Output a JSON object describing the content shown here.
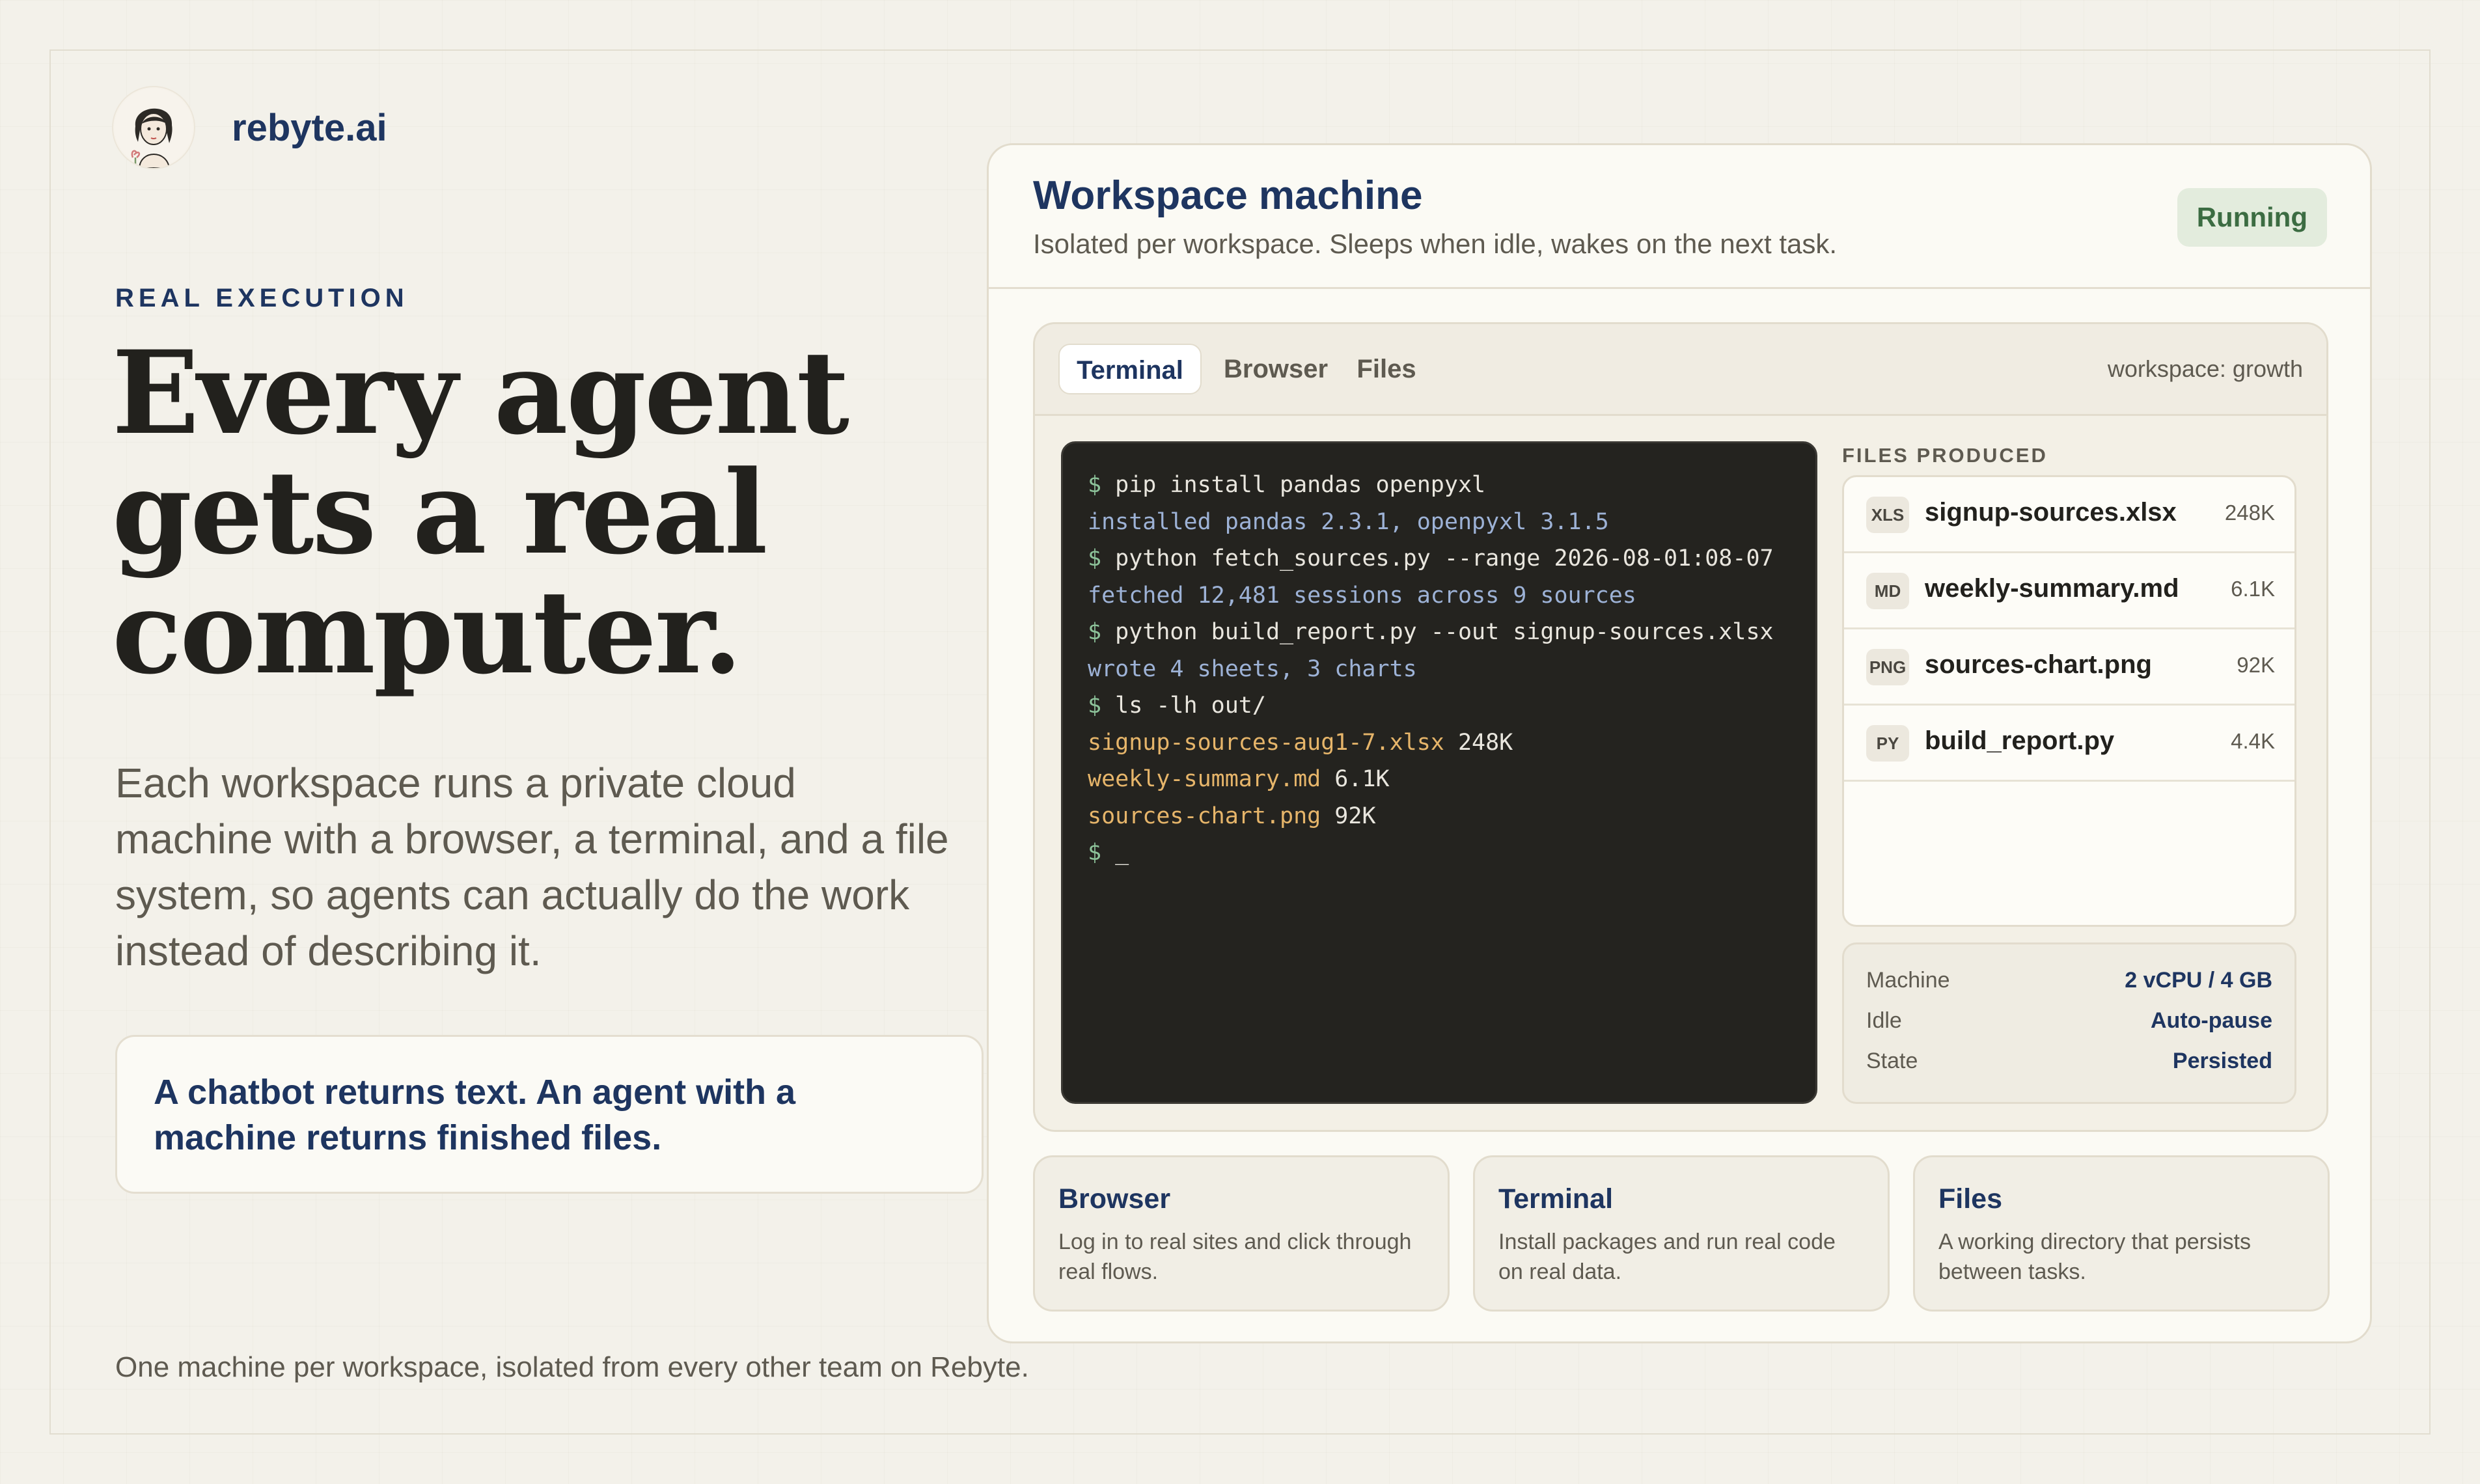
{
  "brand": {
    "name": "rebyte.ai"
  },
  "hero": {
    "eyebrow": "REAL EXECUTION",
    "headline": [
      "Every agent",
      "gets a real",
      "computer."
    ],
    "lede": "Each workspace runs a private cloud machine with a browser, a terminal, and a file system, so agents can actually do the work instead of describing it.",
    "callout": "A chatbot returns text. An agent with a machine returns finished files.",
    "footnote": "One machine per workspace, isolated from every other team on Rebyte."
  },
  "machine": {
    "title": "Workspace machine",
    "subtitle": "Isolated per workspace. Sleeps when idle, wakes on the next task.",
    "status": "Running",
    "status_color": "#3c6c42",
    "tabs": [
      {
        "label": "Terminal",
        "active": true
      },
      {
        "label": "Browser",
        "active": false
      },
      {
        "label": "Files",
        "active": false
      }
    ],
    "workspace_label": "workspace: growth",
    "terminal": [
      {
        "type": "cmd",
        "prompt": "$",
        "text": " pip install pandas openpyxl"
      },
      {
        "type": "out",
        "text": "installed pandas 2.3.1, openpyxl 3.1.5"
      },
      {
        "type": "cmd",
        "prompt": "$",
        "text": " python fetch_sources.py --range 2026-08-01:08-07"
      },
      {
        "type": "out",
        "text": "fetched 12,481 sessions across 9 sources"
      },
      {
        "type": "cmd",
        "prompt": "$",
        "text": " python build_report.py --out signup-sources.xlsx"
      },
      {
        "type": "out",
        "text": "wrote 4 sheets, 3 charts"
      },
      {
        "type": "cmd",
        "prompt": "$",
        "text": " ls -lh out/"
      },
      {
        "type": "file",
        "name": "signup-sources-aug1-7.xlsx",
        "size": " 248K"
      },
      {
        "type": "file",
        "name": "weekly-summary.md",
        "size": " 6.1K"
      },
      {
        "type": "file",
        "name": "sources-chart.png",
        "size": " 92K"
      },
      {
        "type": "cursor",
        "prompt": "$",
        "text": " _"
      }
    ],
    "files_label": "FILES PRODUCED",
    "files": [
      {
        "badge": "XLS",
        "name": "signup-sources.xlsx",
        "size": "248K"
      },
      {
        "badge": "MD",
        "name": "weekly-summary.md",
        "size": "6.1K"
      },
      {
        "badge": "PNG",
        "name": "sources-chart.png",
        "size": "92K"
      },
      {
        "badge": "PY",
        "name": "build_report.py",
        "size": "4.4K"
      }
    ],
    "specs": [
      {
        "key": "Machine",
        "value": "2 vCPU / 4 GB"
      },
      {
        "key": "Idle",
        "value": "Auto-pause"
      },
      {
        "key": "State",
        "value": "Persisted"
      }
    ],
    "features": [
      {
        "title": "Browser",
        "desc": "Log in to real sites and click through real flows."
      },
      {
        "title": "Terminal",
        "desc": "Install packages and run real code on real data."
      },
      {
        "title": "Files",
        "desc": "A working directory that persists between tasks."
      }
    ]
  }
}
